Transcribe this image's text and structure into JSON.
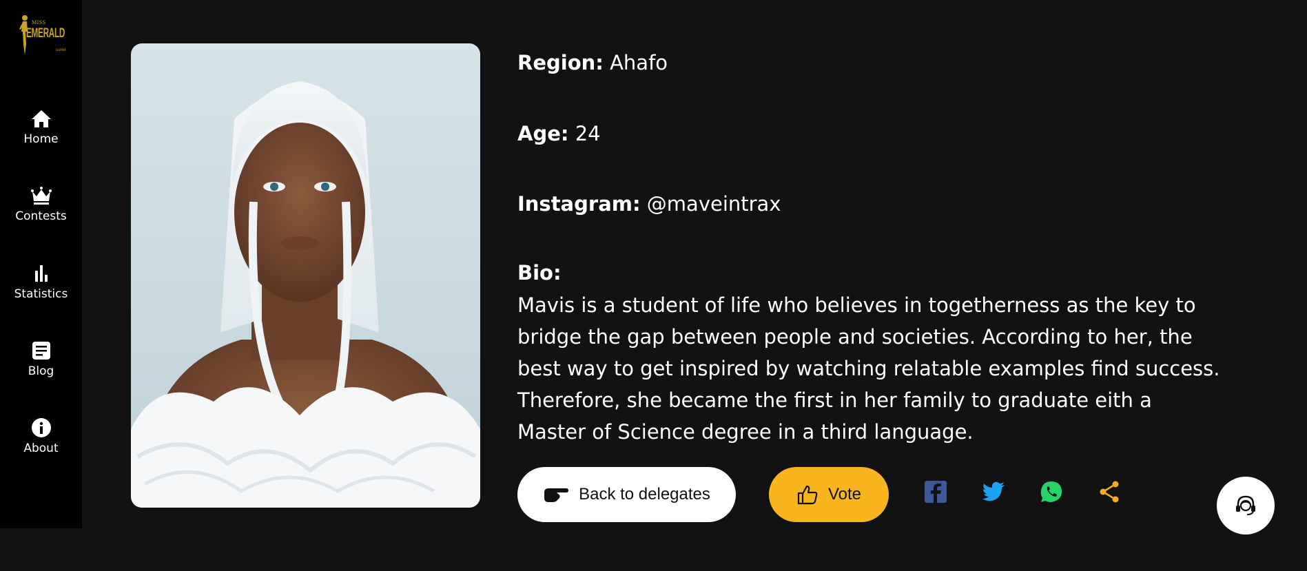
{
  "logo": {
    "line1": "MISS",
    "line2": "EMERALD",
    "line3": "GHANA"
  },
  "nav": {
    "items": [
      {
        "label": "Home",
        "icon": "home-icon"
      },
      {
        "label": "Contests",
        "icon": "crown-icon"
      },
      {
        "label": "Statistics",
        "icon": "bar-chart-icon"
      },
      {
        "label": "Blog",
        "icon": "document-icon"
      },
      {
        "label": "About",
        "icon": "info-icon"
      }
    ]
  },
  "profile": {
    "region_label": "Region:",
    "region_value": "Ahafo",
    "age_label": "Age:",
    "age_value": "24",
    "instagram_label": "Instagram:",
    "instagram_value": "@maveintrax",
    "bio_label": "Bio:",
    "bio_text": "Mavis is a student of life who believes in togetherness as the key to bridge the gap between people and societies. According to her, the best way to get inspired by watching relatable examples find success. Therefore, she became the first in her family to graduate eith a Master of Science degree in a third language."
  },
  "actions": {
    "back_label": "Back to delegates",
    "vote_label": "Vote"
  },
  "social": [
    "facebook-icon",
    "twitter-icon",
    "whatsapp-icon",
    "share-icon"
  ],
  "colors": {
    "background": "#121212",
    "sidebar": "#000000",
    "accent": "#f9b51f",
    "logo_gold": "#c9a227",
    "facebook": "#3b5998",
    "twitter": "#1da1f2",
    "whatsapp": "#25d366",
    "share": "#f9a825"
  }
}
